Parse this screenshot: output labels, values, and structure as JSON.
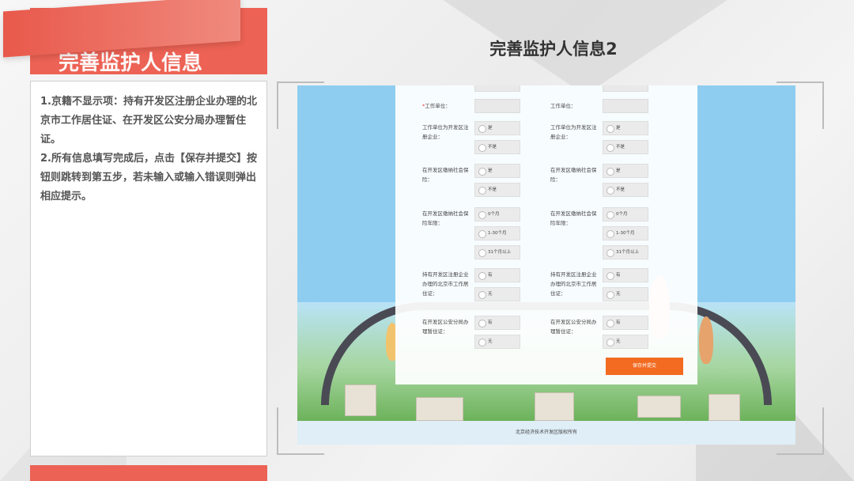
{
  "slide": {
    "title_banner": "完善监护人信息",
    "heading": "完善监护人信息2",
    "notes": [
      "1.京籍不显示项：持有开发区注册企业办理的北京市工作居住证、在开发区公安分局办理暂住证。",
      "2.所有信息填写完成后，点击【保存并提交】按钮则跳转到第五步，若未输入或输入错误则弹出相应提示。"
    ]
  },
  "form": {
    "left": {
      "work_unit_label": "工作单位：",
      "work_unit_req": "*",
      "q1_label": "工作单位为开发区注册企业：",
      "q2_label": "在开发区缴纳社会保险：",
      "q3_label": "在开发区缴纳社会保险年限：",
      "q4_label": "持有开发区注册企业办理的北京市工作居住证：",
      "q5_label": "在开发区公安分局办理暂住证："
    },
    "right": {
      "work_unit_label": "工作单位：",
      "q1_label": "工作单位为开发区注册企业：",
      "q2_label": "在开发区缴纳社会保险：",
      "q3_label": "在开发区缴纳社会保险年限：",
      "q4_label": "持有开发区注册企业办理的北京市工作居住证：",
      "q5_label": "在开发区公安分局办理暂住证："
    },
    "opt_yes": "是",
    "opt_no": "不是",
    "opt_0": "0个月",
    "opt_1_30": "1-30个月",
    "opt_31": "31个月以上",
    "opt_have": "有",
    "opt_none": "无",
    "save_button": "保存并提交",
    "footer": "北京经济技术开发区版权所有"
  },
  "colors": {
    "accent": "#ec6254",
    "button": "#f26b21",
    "sky": "#8fcdf0"
  }
}
